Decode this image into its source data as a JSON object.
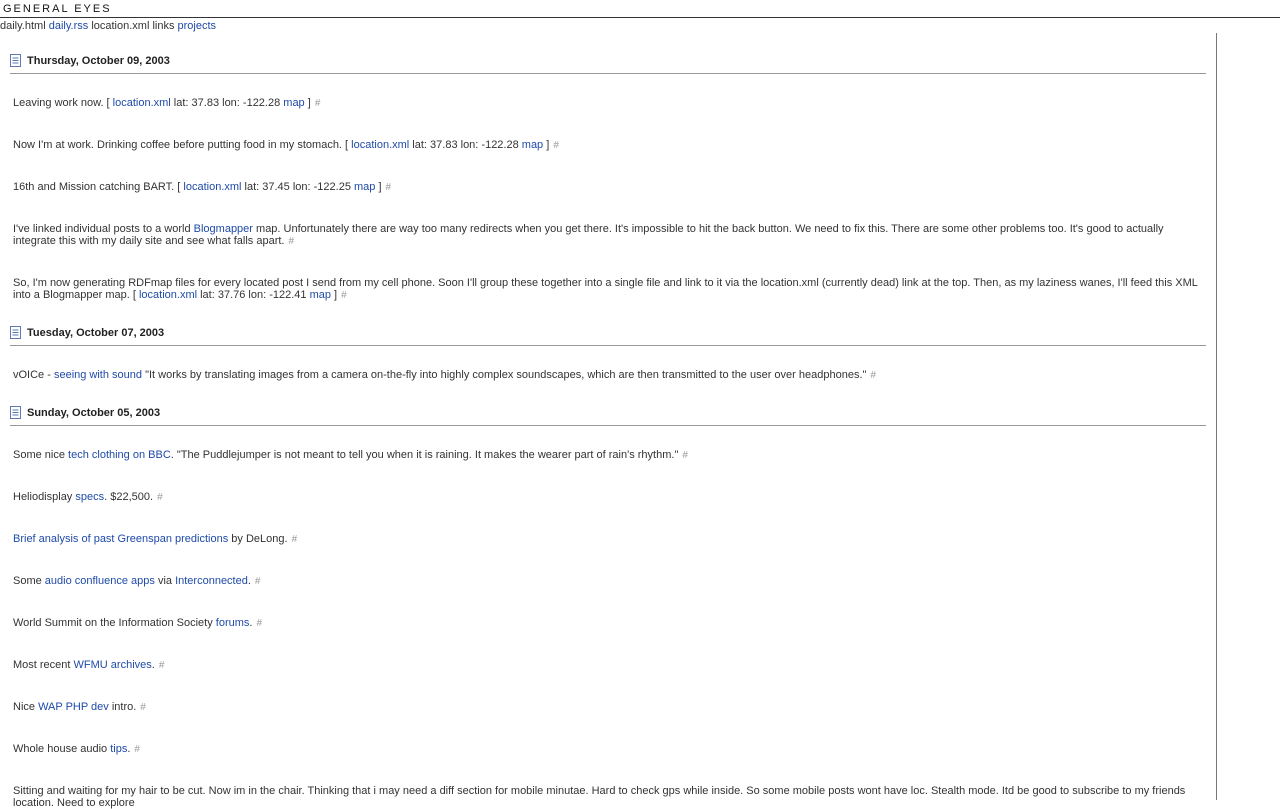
{
  "header": {
    "title": "GENERAL EYES",
    "nav": [
      {
        "label": "daily.html",
        "link": false
      },
      {
        "label": "daily.rss",
        "link": true
      },
      {
        "label": "location.xml",
        "link": false
      },
      {
        "label": "links",
        "link": false
      },
      {
        "label": "projects",
        "link": true
      }
    ]
  },
  "days": [
    {
      "date": "Thursday, October 09, 2003",
      "posts": [
        {
          "segments": [
            {
              "t": "Leaving work now. [ "
            },
            {
              "t": "location.xml",
              "link": true
            },
            {
              "t": " lat: 37.83 lon: -122.28 "
            },
            {
              "t": "map",
              "link": true
            },
            {
              "t": " ]"
            }
          ]
        },
        {
          "segments": [
            {
              "t": "Now I'm at work. Drinking coffee before putting food in my stomach. [ "
            },
            {
              "t": "location.xml",
              "link": true
            },
            {
              "t": " lat: 37.83 lon: -122.28 "
            },
            {
              "t": "map",
              "link": true
            },
            {
              "t": " ]"
            }
          ]
        },
        {
          "segments": [
            {
              "t": "16th and Mission catching BART. [ "
            },
            {
              "t": "location.xml",
              "link": true
            },
            {
              "t": " lat: 37.45 lon: -122.25 "
            },
            {
              "t": "map",
              "link": true
            },
            {
              "t": " ]"
            }
          ]
        },
        {
          "segments": [
            {
              "t": "I've linked individual posts to a world "
            },
            {
              "t": "Blogmapper",
              "link": true
            },
            {
              "t": " map. Unfortunately there are way too many redirects when you get there. It's impossible to hit the back button. We need to fix this. There are some other problems too. It's good to actually integrate this with my daily site and see what falls apart."
            }
          ]
        },
        {
          "segments": [
            {
              "t": "So, I'm now generating RDFmap files for every located post I send from my cell phone. Soon I'll group these together into a single file and link to it via the location.xml (currently dead) link at the top. Then, as my laziness wanes, I'll feed this XML into a Blogmapper map. [ "
            },
            {
              "t": "location.xml",
              "link": true
            },
            {
              "t": " lat: 37.76 lon: -122.41 "
            },
            {
              "t": "map",
              "link": true
            },
            {
              "t": " ]"
            }
          ]
        }
      ]
    },
    {
      "date": "Tuesday, October 07, 2003",
      "posts": [
        {
          "segments": [
            {
              "t": "vOICe - "
            },
            {
              "t": "seeing with sound",
              "link": true
            },
            {
              "t": " \"It works by translating images from a camera on-the-fly into highly complex soundscapes, which are then transmitted to the user over headphones.\""
            }
          ]
        }
      ]
    },
    {
      "date": "Sunday, October 05, 2003",
      "posts": [
        {
          "segments": [
            {
              "t": "Some nice "
            },
            {
              "t": "tech clothing on BBC",
              "link": true
            },
            {
              "t": ". \"The Puddlejumper is not meant to tell you when it is raining. It makes the wearer part of rain's rhythm.\""
            }
          ]
        },
        {
          "segments": [
            {
              "t": "Heliodisplay "
            },
            {
              "t": "specs",
              "link": true
            },
            {
              "t": ". $22,500."
            }
          ]
        },
        {
          "segments": [
            {
              "t": "Brief analysis of past Greenspan predictions",
              "link": true
            },
            {
              "t": " by DeLong."
            }
          ]
        },
        {
          "segments": [
            {
              "t": "Some "
            },
            {
              "t": "audio confluence apps",
              "link": true
            },
            {
              "t": " via "
            },
            {
              "t": "Interconnected",
              "link": true
            },
            {
              "t": "."
            }
          ]
        },
        {
          "segments": [
            {
              "t": "World Summit on the Information Society "
            },
            {
              "t": "forums",
              "link": true
            },
            {
              "t": "."
            }
          ]
        },
        {
          "segments": [
            {
              "t": "Most recent "
            },
            {
              "t": "WFMU archives",
              "link": true
            },
            {
              "t": "."
            }
          ]
        },
        {
          "segments": [
            {
              "t": "Nice "
            },
            {
              "t": "WAP PHP dev",
              "link": true
            },
            {
              "t": " intro."
            }
          ]
        },
        {
          "segments": [
            {
              "t": "Whole house audio "
            },
            {
              "t": "tips",
              "link": true
            },
            {
              "t": "."
            }
          ]
        },
        {
          "segments": [
            {
              "t": "Sitting and waiting for my hair to be cut. Now im in the chair. Thinking that i may need a diff section for mobile minutae. Hard to check gps while inside. So some mobile posts wont have loc. Stealth mode. Itd be good to subscribe to my friends location. Need to explore"
            }
          ]
        }
      ]
    }
  ],
  "permalink_symbol": "#",
  "colors": {
    "link": "#1f4aa8",
    "text": "#333333",
    "rule": "#999999"
  }
}
